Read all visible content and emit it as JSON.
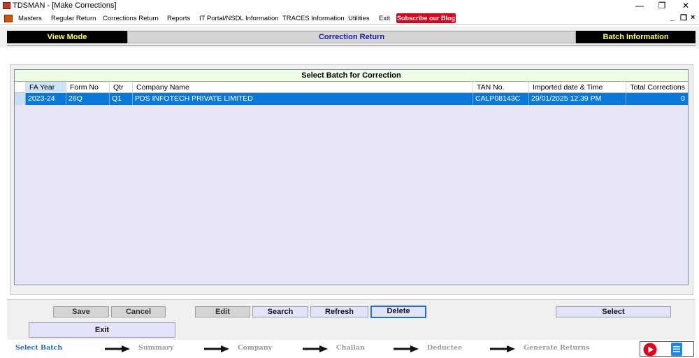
{
  "window": {
    "title": "TDSMAN - [Make Corrections]"
  },
  "menu": {
    "items": [
      "Masters",
      "Regular Return",
      "Corrections Return",
      "Reports",
      "IT Portal/NSDL Information",
      "TRACES Information",
      "Utilities",
      "Exit"
    ],
    "blog_button": "Subscribe our Blog"
  },
  "header": {
    "left": "View Mode",
    "center": "Correction Return",
    "right": "Batch Information"
  },
  "grid": {
    "title": "Select Batch for Correction",
    "columns": [
      "FA Year",
      "Form No",
      "Qtr",
      "Company Name",
      "TAN No.",
      "Imported date & Time",
      "Total Corrections"
    ],
    "rows": [
      {
        "fa_year": "2023-24",
        "form_no": "26Q",
        "qtr": "Q1",
        "company": "PDS INFOTECH PRIVATE LIMITED",
        "tan": "CALP08143C",
        "imported": "29/01/2025 12:39 PM",
        "total": "0"
      }
    ]
  },
  "buttons": {
    "save": "Save",
    "cancel": "Cancel",
    "edit": "Edit",
    "search": "Search",
    "refresh": "Refresh",
    "delete": "Delete",
    "select": "Select",
    "exit": "Exit"
  },
  "steps": [
    "Select Batch",
    "Summary",
    "Company",
    "Challan",
    "Deductee",
    "Generate Returns"
  ],
  "icons": {
    "play": "youtube-play-icon",
    "doc": "document-icon"
  },
  "colors": {
    "selection": "#0a78d7",
    "header_text": "#ffff66",
    "blog": "#e0001b"
  }
}
